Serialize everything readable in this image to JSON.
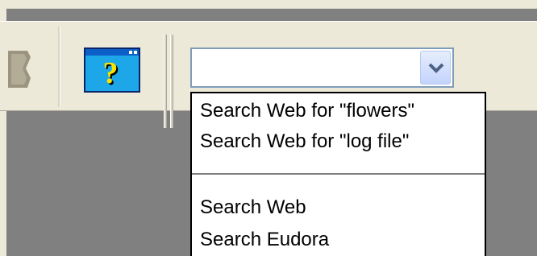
{
  "toolbar": {
    "help_icon": "help-question-mark-window-icon",
    "partial_icon": "toolbar-button-icon"
  },
  "search": {
    "value": "",
    "dropdown_icon": "chevron-down-icon"
  },
  "dropdown": {
    "items": [
      {
        "label": "Search Web for \"flowers\""
      },
      {
        "label": "Search Web for \"log file\""
      },
      {
        "label": "Search Web"
      },
      {
        "label": "Search Eudora"
      }
    ]
  },
  "colors": {
    "toolbar_bg": "#ece9d8",
    "workspace_bg": "#808080",
    "combo_border": "#7f9db9"
  }
}
